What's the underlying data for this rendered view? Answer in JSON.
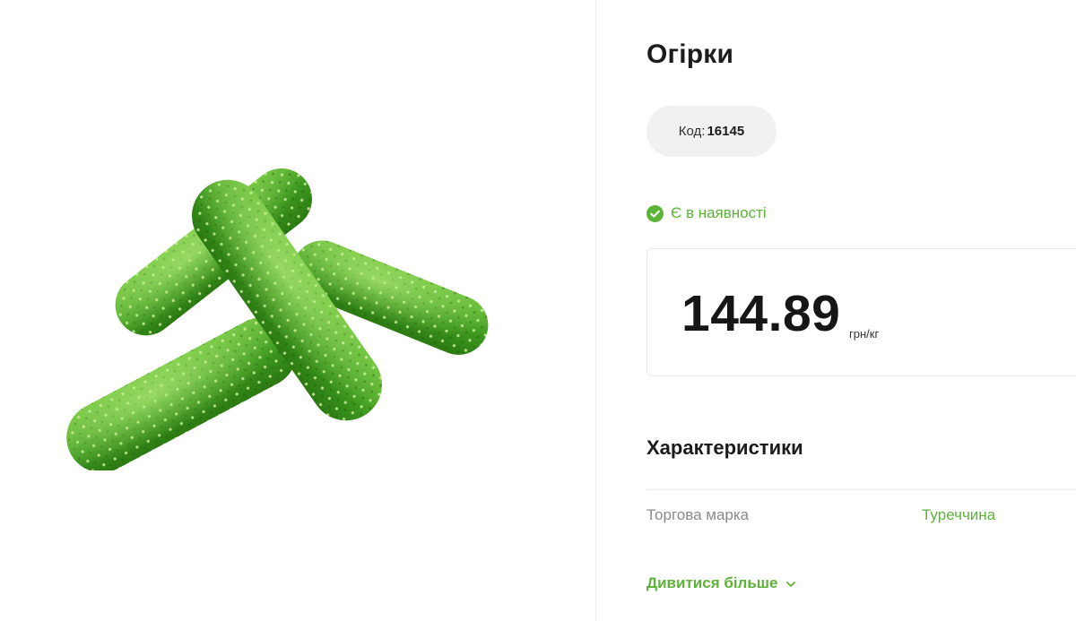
{
  "product": {
    "title": "Огірки",
    "code_label": "Код:",
    "code_value": "16145",
    "availability": "Є в наявності",
    "image_icon": "cucumbers-photo"
  },
  "price": {
    "amount": "144.89",
    "unit": "грн/кг"
  },
  "specs": {
    "title": "Характеристики",
    "rows": [
      {
        "label": "Торгова марка",
        "value": "Туреччина"
      }
    ],
    "see_more": "Дивитися більше"
  },
  "colors": {
    "accent": "#5cb338",
    "pill_bg": "#f1f1f1",
    "text": "#1c1c1c",
    "muted": "#8a8a8a"
  }
}
